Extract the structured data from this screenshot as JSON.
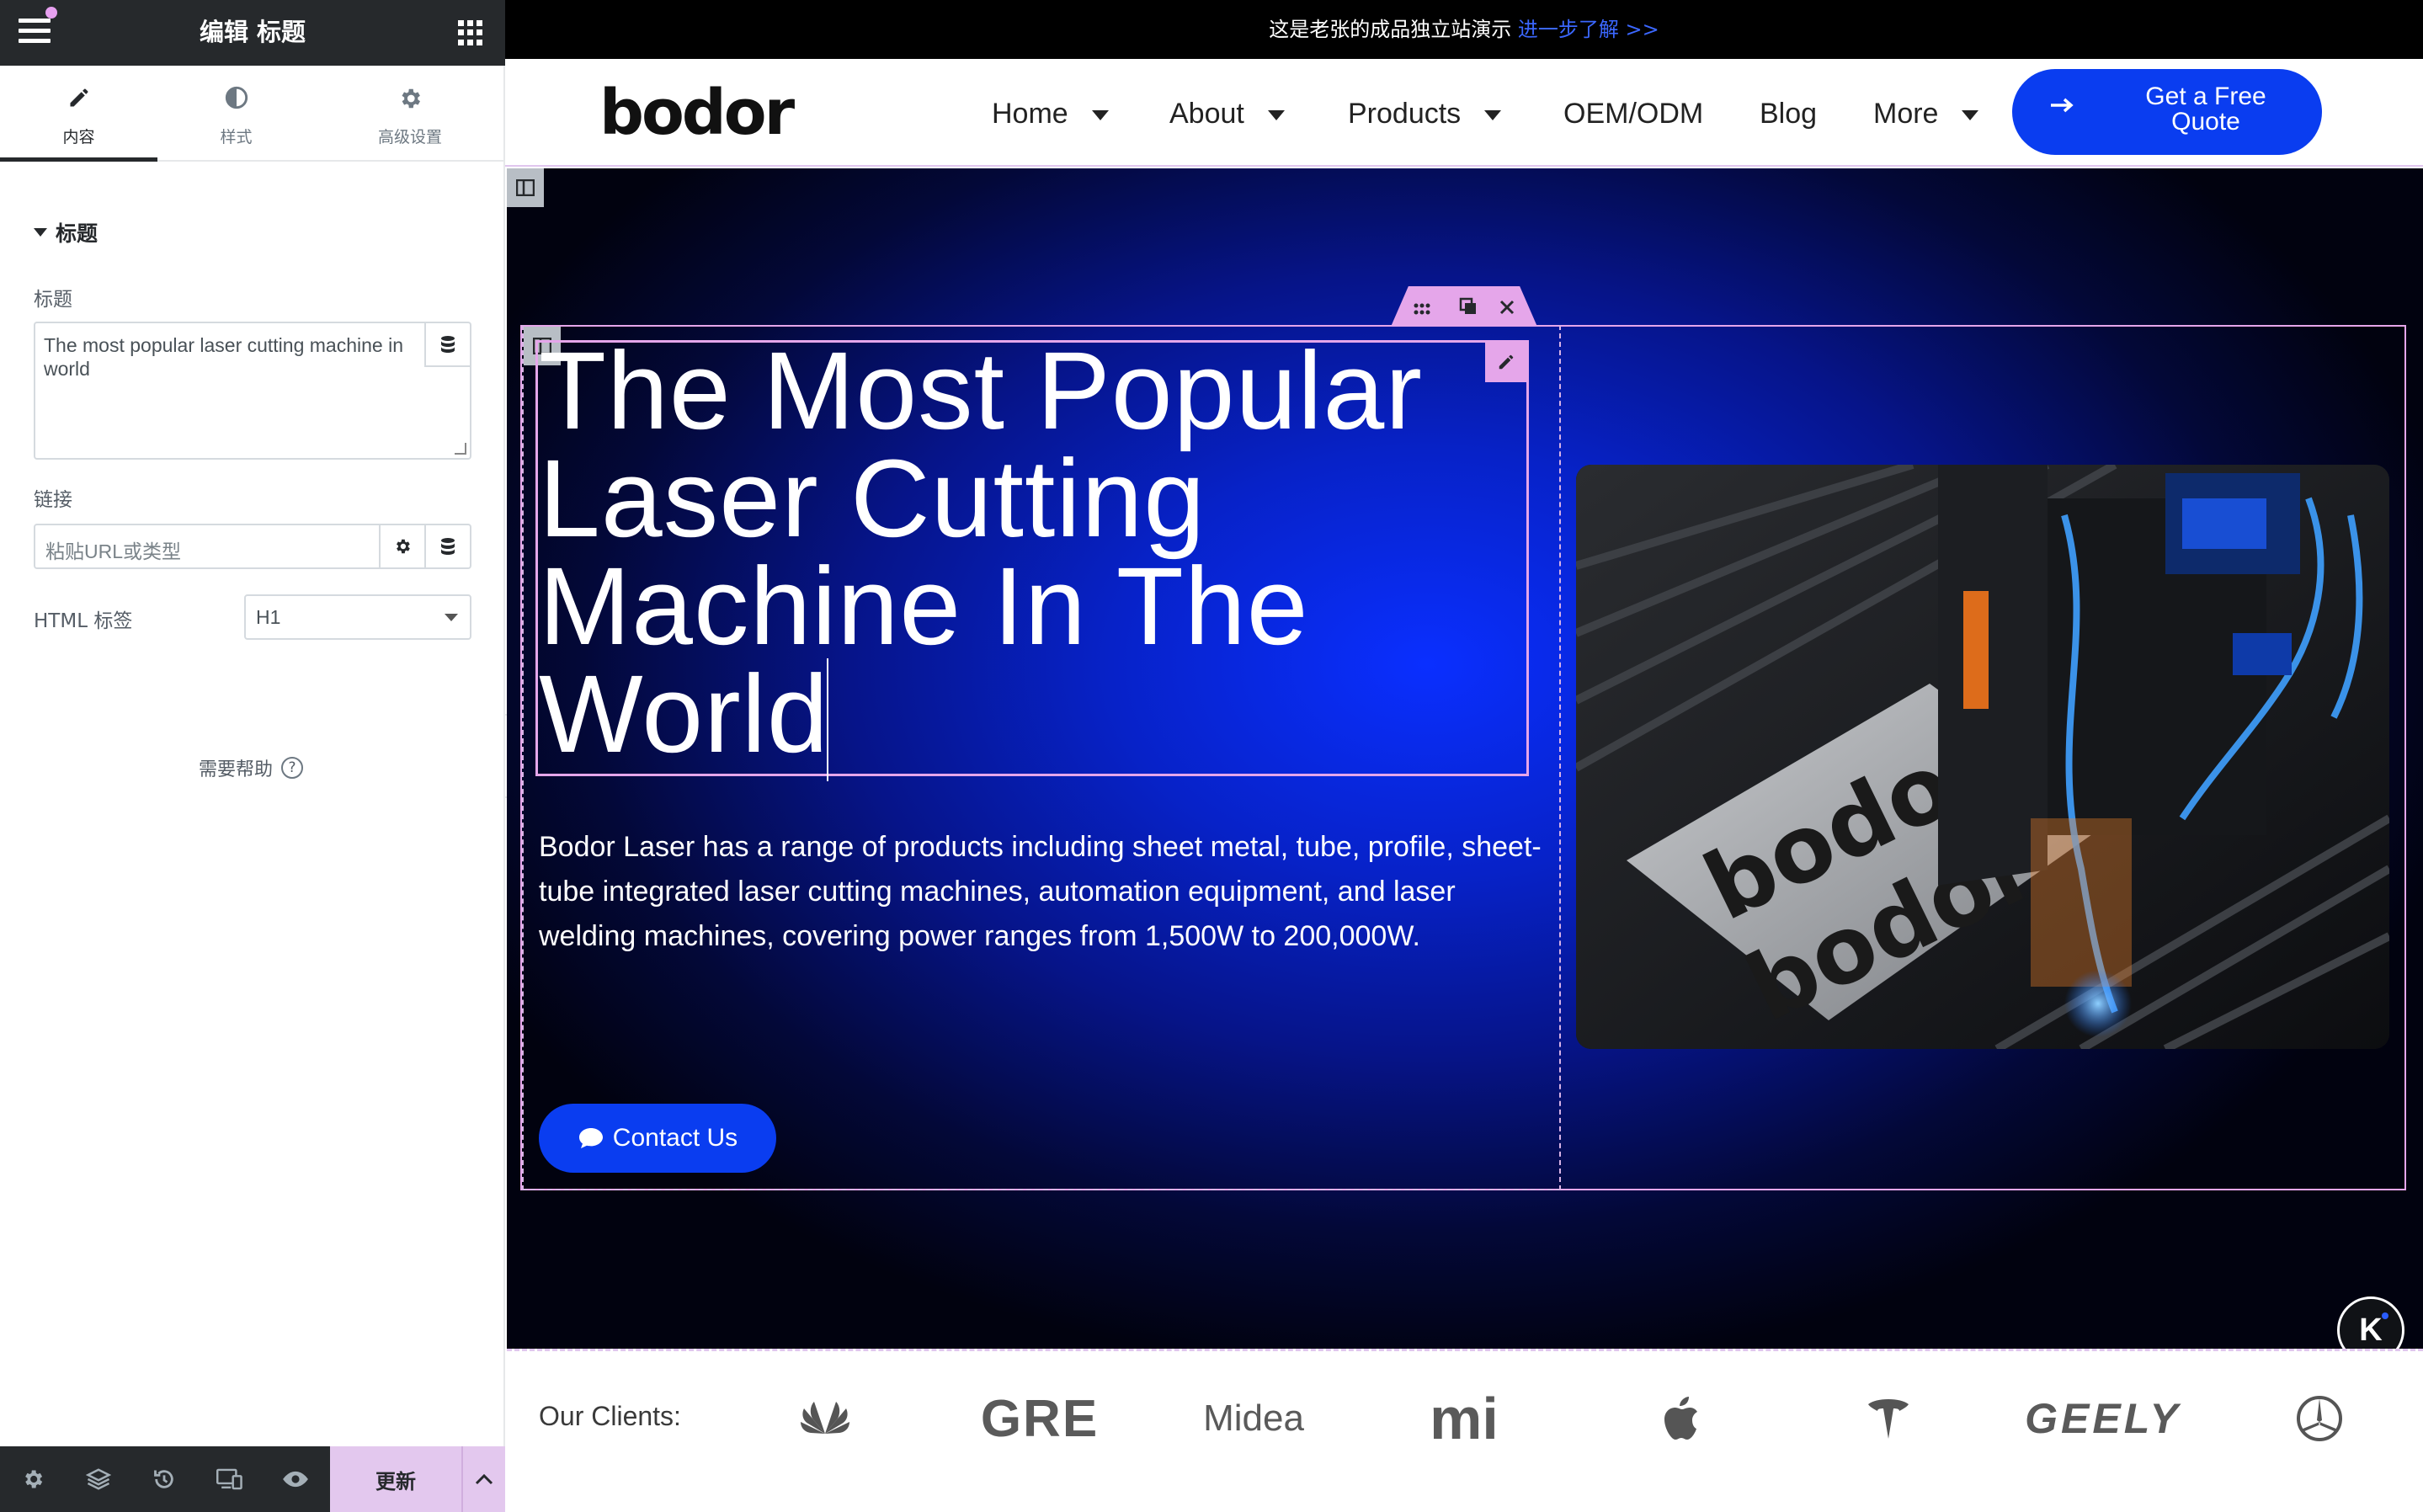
{
  "panel": {
    "title": "编辑 标题",
    "tabs": [
      {
        "label": "内容",
        "icon": "pencil-icon"
      },
      {
        "label": "样式",
        "icon": "contrast-icon"
      },
      {
        "label": "高级设置",
        "icon": "gear-icon"
      }
    ],
    "section_title": "标题",
    "title_field_label": "标题",
    "title_field_value": "The most popular laser cutting machine in world",
    "link_label": "链接",
    "link_placeholder": "粘贴URL或类型",
    "html_tag_label": "HTML 标签",
    "html_tag_value": "H1",
    "help_text": "需要帮助",
    "footer": {
      "update_label": "更新"
    }
  },
  "site": {
    "announcement": "这是老张的成品独立站演示",
    "announcement_link": "进一步了解 >>",
    "logo": "bodor",
    "nav": [
      {
        "label": "Home",
        "dropdown": true
      },
      {
        "label": "About",
        "dropdown": true
      },
      {
        "label": "Products",
        "dropdown": true
      },
      {
        "label": "OEM/ODM",
        "dropdown": false
      },
      {
        "label": "Blog",
        "dropdown": false
      },
      {
        "label": "More",
        "dropdown": true
      }
    ],
    "cta_line1": "Get a Free",
    "cta_line2": "Quote",
    "hero": {
      "heading": [
        "The Most Popular",
        "Laser Cutting",
        "Machine In The",
        "World"
      ],
      "description": "Bodor Laser has a range of products including sheet metal, tube, profile, sheet-tube integrated laser cutting machines, automation equipment, and laser welding machines, covering power ranges from 1,500W to 200,000W.",
      "contact_label": "Contact Us",
      "image_text": [
        "bodor",
        "bodor"
      ]
    },
    "clients_label": "Our Clients:",
    "clients": [
      "huawei-logo",
      "GRE",
      "Midea",
      "mi",
      "apple-logo",
      "tesla-logo",
      "GEELY",
      "mercedes-logo"
    ],
    "badge": "K"
  },
  "colors": {
    "accent_blue": "#0a3df0",
    "editor_dark": "#26292c",
    "selection_pink": "#e5a6ea"
  }
}
